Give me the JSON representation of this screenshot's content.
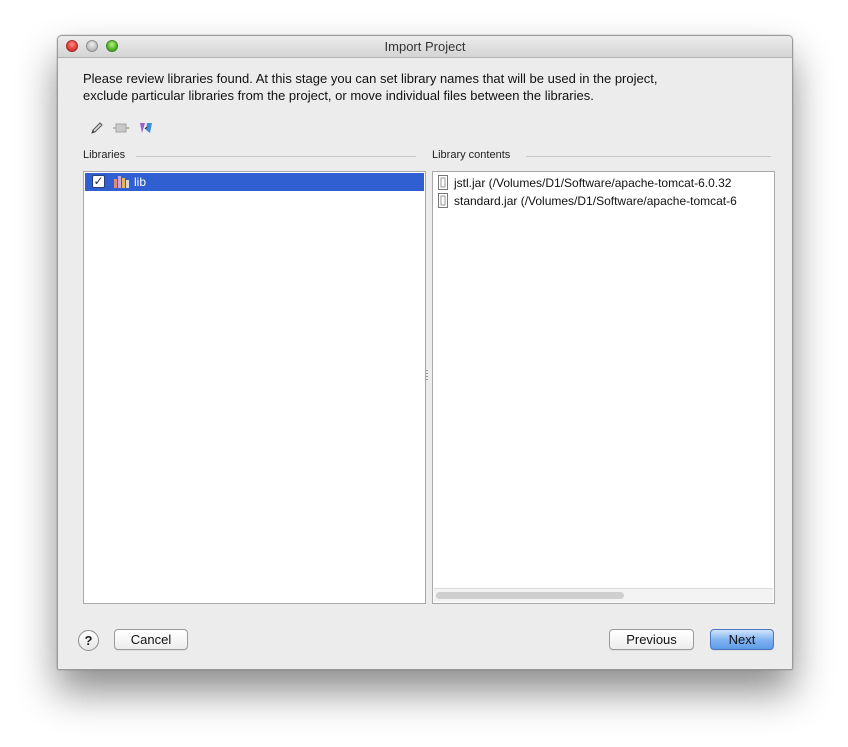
{
  "window": {
    "title": "Import Project"
  },
  "intro": {
    "line1": "Please review libraries found. At this stage you can set library names that will be used in the project,",
    "line2": "exclude particular libraries from the project, or move individual files between the libraries."
  },
  "toolbar": {
    "icons": [
      "pencil-icon",
      "merge-icon",
      "split-icon"
    ]
  },
  "libraries": {
    "label": "Libraries",
    "items": [
      {
        "name": "lib",
        "checked": true,
        "selected": true
      }
    ]
  },
  "contents": {
    "label": "Library contents",
    "files": [
      {
        "name": "jstl.jar (/Volumes/D1/Software/apache-tomcat-6.0.32"
      },
      {
        "name": "standard.jar (/Volumes/D1/Software/apache-tomcat-6"
      }
    ]
  },
  "buttons": {
    "help": "?",
    "cancel": "Cancel",
    "previous": "Previous",
    "next": "Next"
  },
  "colors": {
    "selection": "#2f5fd0",
    "default_button": "#7eb1ef"
  }
}
